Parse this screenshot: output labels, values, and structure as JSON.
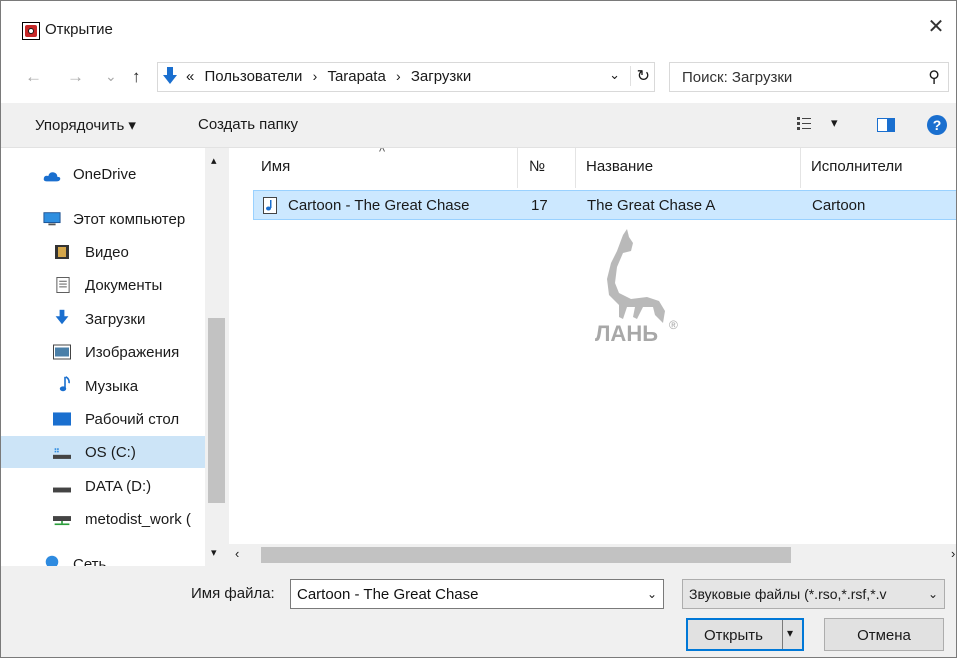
{
  "window": {
    "title": "Открытие",
    "close_glyph": "✕"
  },
  "nav": {
    "back_glyph": "←",
    "forward_glyph": "→",
    "recent_glyph": "⌄",
    "up_glyph": "↑",
    "breadcrumb_prefix": "«",
    "breadcrumb": [
      "Пользователи",
      "Tarapata",
      "Загрузки"
    ],
    "breadcrumb_sep": "›",
    "dropdown_glyph": "⌄",
    "refresh_glyph": "↻"
  },
  "search": {
    "placeholder": "Поиск: Загрузки",
    "icon_glyph": "⚲"
  },
  "toolbar": {
    "organize_label": "Упорядочить ▾",
    "new_folder_label": "Создать папку",
    "view_dropdown_glyph": "▾",
    "help_glyph": "?"
  },
  "sidebar": {
    "items": [
      {
        "label": "OneDrive",
        "icon": "cloud-icon"
      },
      {
        "label": "Этот компьютер",
        "icon": "computer-icon"
      },
      {
        "label": "Видео",
        "icon": "video-icon"
      },
      {
        "label": "Документы",
        "icon": "documents-icon"
      },
      {
        "label": "Загрузки",
        "icon": "downloads-icon"
      },
      {
        "label": "Изображения",
        "icon": "pictures-icon"
      },
      {
        "label": "Музыка",
        "icon": "music-icon"
      },
      {
        "label": "Рабочий стол",
        "icon": "desktop-icon"
      },
      {
        "label": "OS (C:)",
        "icon": "drive-c-icon"
      },
      {
        "label": "DATA (D:)",
        "icon": "drive-d-icon"
      },
      {
        "label": "metodist_work (",
        "icon": "network-drive-icon"
      },
      {
        "label": "Сеть",
        "icon": "network-icon"
      }
    ],
    "scroll_up_glyph": "▴",
    "scroll_down_glyph": "▾"
  },
  "columns": {
    "name": "Имя",
    "number": "№",
    "title": "Название",
    "artists": "Исполнители",
    "sort_glyph": "^"
  },
  "files": [
    {
      "name": "Cartoon - The Great Chase",
      "number": "17",
      "title": "The Great Chase A",
      "artists": "Cartoon",
      "icon": "audio-file-icon"
    }
  ],
  "hscroll": {
    "left_glyph": "‹",
    "right_glyph": "›"
  },
  "watermark": {
    "text": "ЛАНЬ",
    "mark": "®"
  },
  "footer": {
    "filename_label": "Имя файла:",
    "filename_value": "Cartoon - The Great Chase",
    "dropdown_glyph": "⌄",
    "filter_label": "Звуковые файлы (*.rso,*.rsf,*.v",
    "open_label": "Открыть",
    "open_split_glyph": "▾",
    "cancel_label": "Отмена"
  },
  "colors": {
    "selection": "#cce8ff",
    "accent": "#0078d7",
    "brand": "#c62828"
  }
}
